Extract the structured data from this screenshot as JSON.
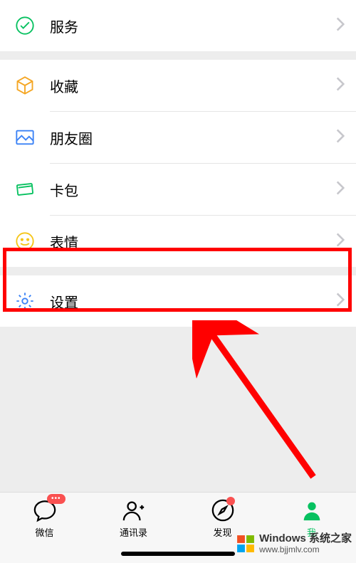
{
  "rows": {
    "services": {
      "label": "服务"
    },
    "favorites": {
      "label": "收藏"
    },
    "moments": {
      "label": "朋友圈"
    },
    "cards": {
      "label": "卡包"
    },
    "sticker": {
      "label": "表情"
    },
    "settings": {
      "label": "设置"
    }
  },
  "colors": {
    "accent": "#07c160",
    "blue": "#3b82f6",
    "yellow": "#f5c518",
    "red": "#fa5151",
    "highlight": "#ff0000",
    "chevron": "#c7c7cc",
    "winBlue": "#0078D4",
    "winGreen": "#7FBA00",
    "winYellow": "#FFB900",
    "winRed": "#F25022"
  },
  "tabs": {
    "chat": {
      "label": "微信"
    },
    "contacts": {
      "label": "通讯录"
    },
    "discover": {
      "label": "发现"
    },
    "me": {
      "label": "我"
    }
  },
  "watermark": {
    "line1": "Windows 系统之家",
    "line2": "www.bjjmlv.com"
  }
}
